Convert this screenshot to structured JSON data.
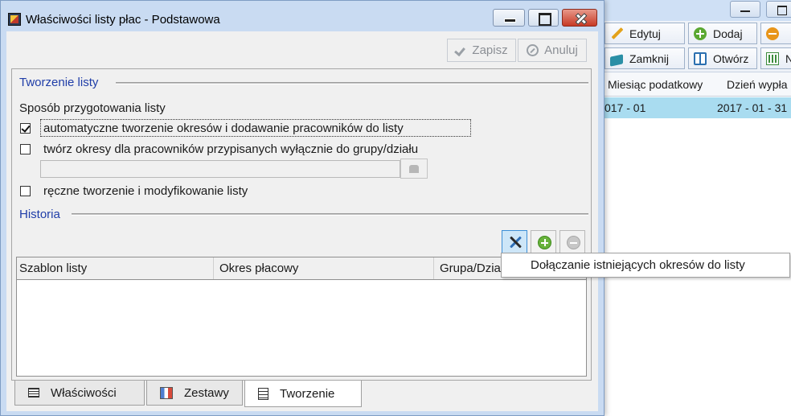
{
  "dialog": {
    "title": "Właściwości listy płac - Podstawowa",
    "actions": {
      "save": "Zapisz",
      "cancel": "Anuluj"
    },
    "sections": {
      "creation": {
        "title": "Tworzenie listy",
        "method_label": "Sposób przygotowania listy",
        "options": [
          {
            "label": "automatyczne tworzenie okresów i dodawanie pracowników do listy",
            "checked": true
          },
          {
            "label": "twórz okresy dla pracowników przypisanych wyłącznie do grupy/działu",
            "checked": false
          },
          {
            "label": "ręczne tworzenie i modyfikowanie listy",
            "checked": false
          }
        ],
        "group_field": {
          "value": ""
        }
      },
      "history": {
        "title": "Historia",
        "columns": [
          "Szablon listy",
          "Okres płacowy",
          "Grupa/Dział"
        ],
        "rows": []
      }
    },
    "tooltip": "Dołączanie istniejących okresów do listy",
    "tabs": [
      {
        "label": "Właściwości",
        "icon": "list-icon",
        "active": false
      },
      {
        "label": "Zestawy",
        "icon": "set-icon",
        "active": false
      },
      {
        "label": "Tworzenie",
        "icon": "document-icon",
        "active": true
      }
    ]
  },
  "background_window": {
    "toolbar": [
      {
        "label": "Edytuj",
        "icon": "pencil-icon"
      },
      {
        "label": "Dodaj",
        "icon": "plus-icon"
      },
      {
        "label": "",
        "icon": "minus-icon"
      },
      {
        "label": "Zamknij",
        "icon": "book-icon"
      },
      {
        "label": "Otwórz",
        "icon": "open-book-icon"
      },
      {
        "label": "N",
        "icon": "calculator-icon"
      }
    ],
    "columns": [
      "Miesiąc podatkowy",
      "Dzień wypła"
    ],
    "row": {
      "month": "017 - 01",
      "pay_day": "2017 - 01 - 31"
    }
  },
  "colors": {
    "section_title": "#1f3da8",
    "selected_row": "#a9dcf0",
    "title_bar": "#c9dbf2",
    "close_button": "#c73a25"
  }
}
